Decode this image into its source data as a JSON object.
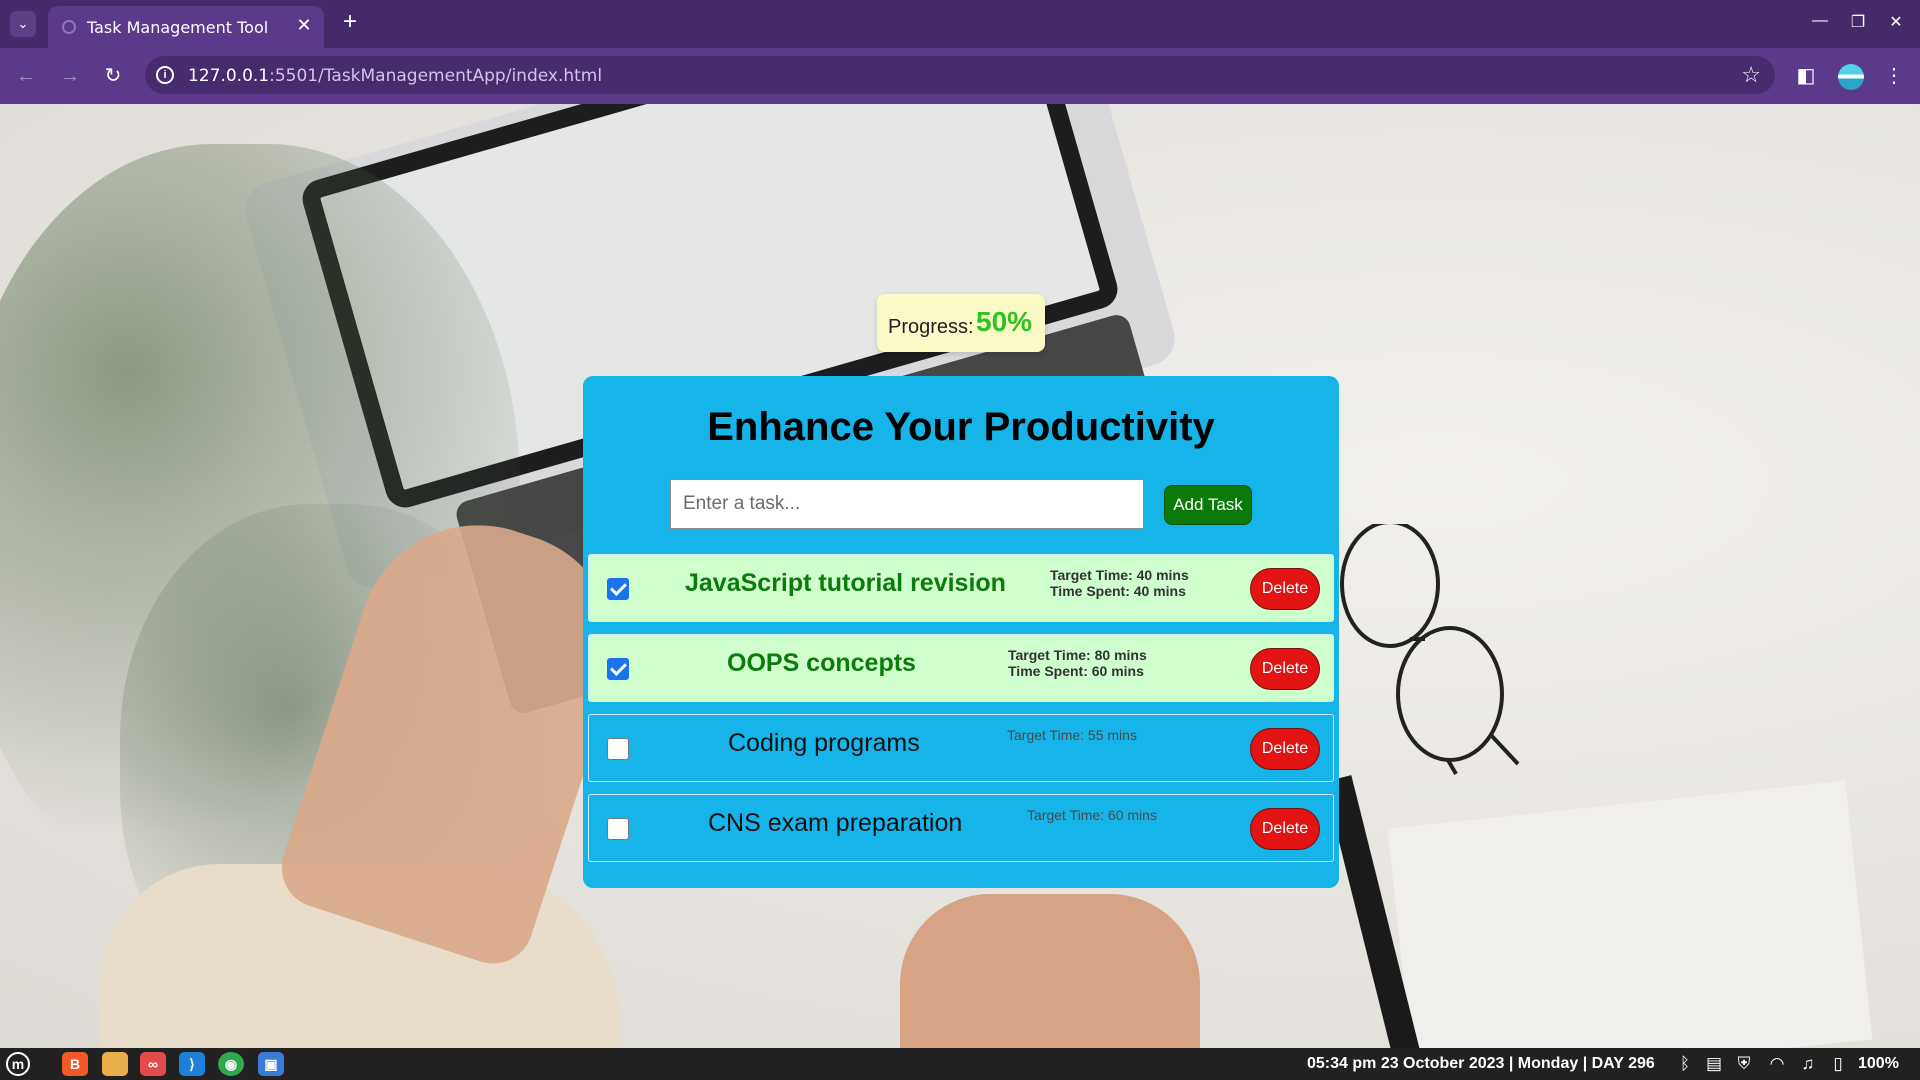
{
  "browser": {
    "tab_title": "Task Management Tool",
    "tab_close_glyph": "✕",
    "new_tab_glyph": "+",
    "url_host": "127.0.0.1",
    "url_path": ":5501/TaskManagementApp/index.html",
    "window_buttons": [
      "minimize-icon",
      "restore-icon",
      "close-icon"
    ]
  },
  "app": {
    "progress_label": "Progress:",
    "progress_value": "50%",
    "progress_percent": 50,
    "title": "Enhance Your Productivity",
    "input_placeholder": "Enter a task...",
    "add_label": "Add Task",
    "tasks": [
      {
        "name": "JavaScript tutorial revision",
        "completed": true,
        "target": "Target Time: 40 mins",
        "spent": "Time Spent: 40 mins",
        "delete_label": "Delete"
      },
      {
        "name": "OOPS concepts",
        "completed": true,
        "target": "Target Time: 80 mins",
        "spent": "Time Spent: 60 mins",
        "delete_label": "Delete"
      },
      {
        "name": "Coding programs",
        "completed": false,
        "target": "Target Time: 55 mins",
        "delete_label": "Delete"
      },
      {
        "name": "CNS exam preparation",
        "completed": false,
        "target": "Target Time: 60 mins",
        "delete_label": "Delete"
      }
    ]
  },
  "taskbar": {
    "apps": [
      "menu-icon",
      "brave-icon",
      "files-icon",
      "extension-icon",
      "vscode-icon",
      "chrome-icon",
      "screenshot-icon"
    ],
    "clock": "05:34 pm  23 October 2023 |  Monday | DAY 296",
    "battery": "100%"
  },
  "colors": {
    "card": "#16b4e8",
    "done_row": "#ceffcc",
    "add_button": "#0b7a0b",
    "delete_button": "#e31414",
    "progress_box": "#fbfac6",
    "progress_value": "#2ec321"
  }
}
